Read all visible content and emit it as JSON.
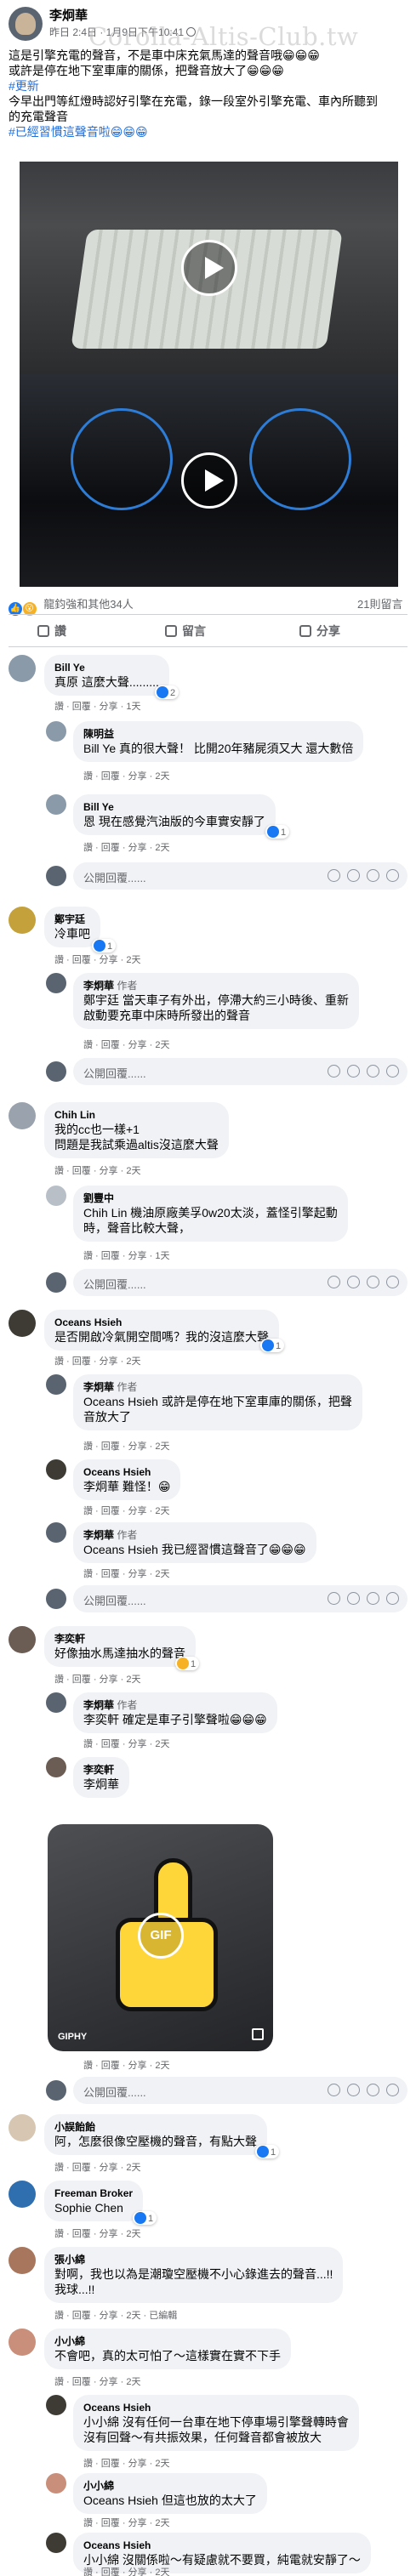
{
  "post": {
    "author": "李炯華",
    "time": "昨日 2:4日 · 1月9日下午10:41",
    "watermark": "Corolla-Altis-Club.tw",
    "lines": [
      "這是引擎充電的聲音，不是車中床充氣馬達的聲音哦😁😁😁",
      "或許是停在地下室車庫的關係，把聲音放大了😁😁😁",
      "#更新",
      "今早出門等紅燈時認好引擎在充電，錄一段室外引擎充電、車內所聽到",
      "的充電聲音",
      "#已經習慣這聲音啦😁😁😁"
    ],
    "reactions_text": "龍鈞強和其他34人",
    "comments_count": "21則留言",
    "actions": {
      "like": "讚",
      "comment": "留言",
      "share": "分享"
    }
  },
  "comments": [
    {
      "name": "Bill Ye",
      "text": "真原 這麼大聲.........",
      "meta": "讚 · 回覆 · 分享 · 1天",
      "rc": "2"
    },
    {
      "name": "陳明益",
      "text": "Bill Ye 真的很大聲！ 比開20年豬屍須又大 還大數倍",
      "meta": "讚 · 回覆 · 分享 · 2天"
    },
    {
      "name": "Bill Ye",
      "text": "恩 現在感覺汽油版的今車實安靜了",
      "meta": "讚 · 回覆 · 分享 · 2天",
      "rc": "1"
    },
    {
      "name": "鄭宇廷",
      "text": "冷車吧",
      "meta": "讚 · 回覆 · 分享 · 2天",
      "rc": "1"
    },
    {
      "name": "李炯華",
      "tag": "作者",
      "lines": [
        "鄭宇廷 當天車子有外出，停滯大約三小時後、重新",
        "啟動要充車中床時所發出的聲音"
      ],
      "meta": "讚 · 回覆 · 分享 · 2天"
    },
    {
      "name": "Chih Lin",
      "lines": [
        "我的cc也一樣+1",
        "問題是我試乘過altis沒這麼大聲"
      ],
      "meta": "讚 · 回覆 · 分享 · 2天"
    },
    {
      "name": "劉豐中",
      "lines": [
        "Chih Lin 機油原廠美孚0w20太淡，蓋怪引擎起動",
        "時，聲音比較大聲，"
      ],
      "meta": "讚 · 回覆 · 分享 · 1天"
    },
    {
      "name": "Oceans Hsieh",
      "text": "是否開啟冷氣開空間嗎？我的沒這麼大聲",
      "meta": "讚 · 回覆 · 分享 · 2天",
      "rc": "1"
    },
    {
      "name": "李炯華",
      "tag": "作者",
      "lines": [
        "Oceans Hsieh 或許是停在地下室車庫的關係，把聲",
        "音放大了"
      ],
      "meta": "讚 · 回覆 · 分享 · 2天"
    },
    {
      "name": "Oceans Hsieh",
      "text": "李炯華 難怪！😁",
      "meta": "讚 · 回覆 · 分享 · 2天"
    },
    {
      "name": "李炯華",
      "tag": "作者",
      "text": "Oceans Hsieh 我已經習慣這聲音了😁😁😁",
      "meta": "讚 · 回覆 · 分享 · 2天"
    },
    {
      "name": "李奕軒",
      "text": "好像抽水馬達抽水的聲音",
      "meta": "讚 · 回覆 · 分享 · 2天",
      "rc": "1"
    },
    {
      "name": "李炯華",
      "tag": "作者",
      "text": "李奕軒 確定是車子引擎聲啦😁😁😁",
      "meta": "讚 · 回覆 · 分享 · 2天"
    },
    {
      "name": "李奕軒",
      "text": "李炯華",
      "gif_label": "GIF",
      "gif_source": "GIPHY",
      "meta": "讚 · 回覆 · 分享 · 2天"
    },
    {
      "name": "小誤飴飴",
      "text": "阿，怎麼很像空壓機的聲音，有點大聲",
      "meta": "讚 · 回覆 · 分享 · 2天",
      "rc": "1"
    },
    {
      "name": "Freeman Broker",
      "text": "Sophie Chen",
      "meta": "讚 · 回覆 · 分享 · 2天",
      "rc": "1"
    },
    {
      "name": "張小綿",
      "lines": [
        "對啊，我也以為是潮瓊空壓機不小心錄進去的聲音...!!",
        "我球...!!"
      ],
      "meta": "讚 · 回覆 · 分享 · 2天 · 已編輯"
    },
    {
      "name": "小小綿",
      "text": "不會吧，真的太可怕了～這樣實在實不下手",
      "meta": "讚 · 回覆 · 分享 · 2天"
    },
    {
      "name": "Oceans Hsieh",
      "lines": [
        "小小綿 沒有任何一台車在地下停車場引擎聲轉時會",
        "沒有回聲～有共振效果，任何聲音都會被放大"
      ],
      "meta": "讚 · 回覆 · 分享 · 2天"
    },
    {
      "name": "小小綿",
      "text": "Oceans Hsieh 但這也放的太大了",
      "meta": "讚 · 回覆 · 分享 · 2天"
    },
    {
      "name": "Oceans Hsieh",
      "lines": [
        "小小綿 沒關係啦～有疑慮就不要買，純電就安靜了～"
      ],
      "meta": "讚 · 回覆 · 分享 · 2天"
    }
  ],
  "reply_placeholder": "公開回覆......"
}
